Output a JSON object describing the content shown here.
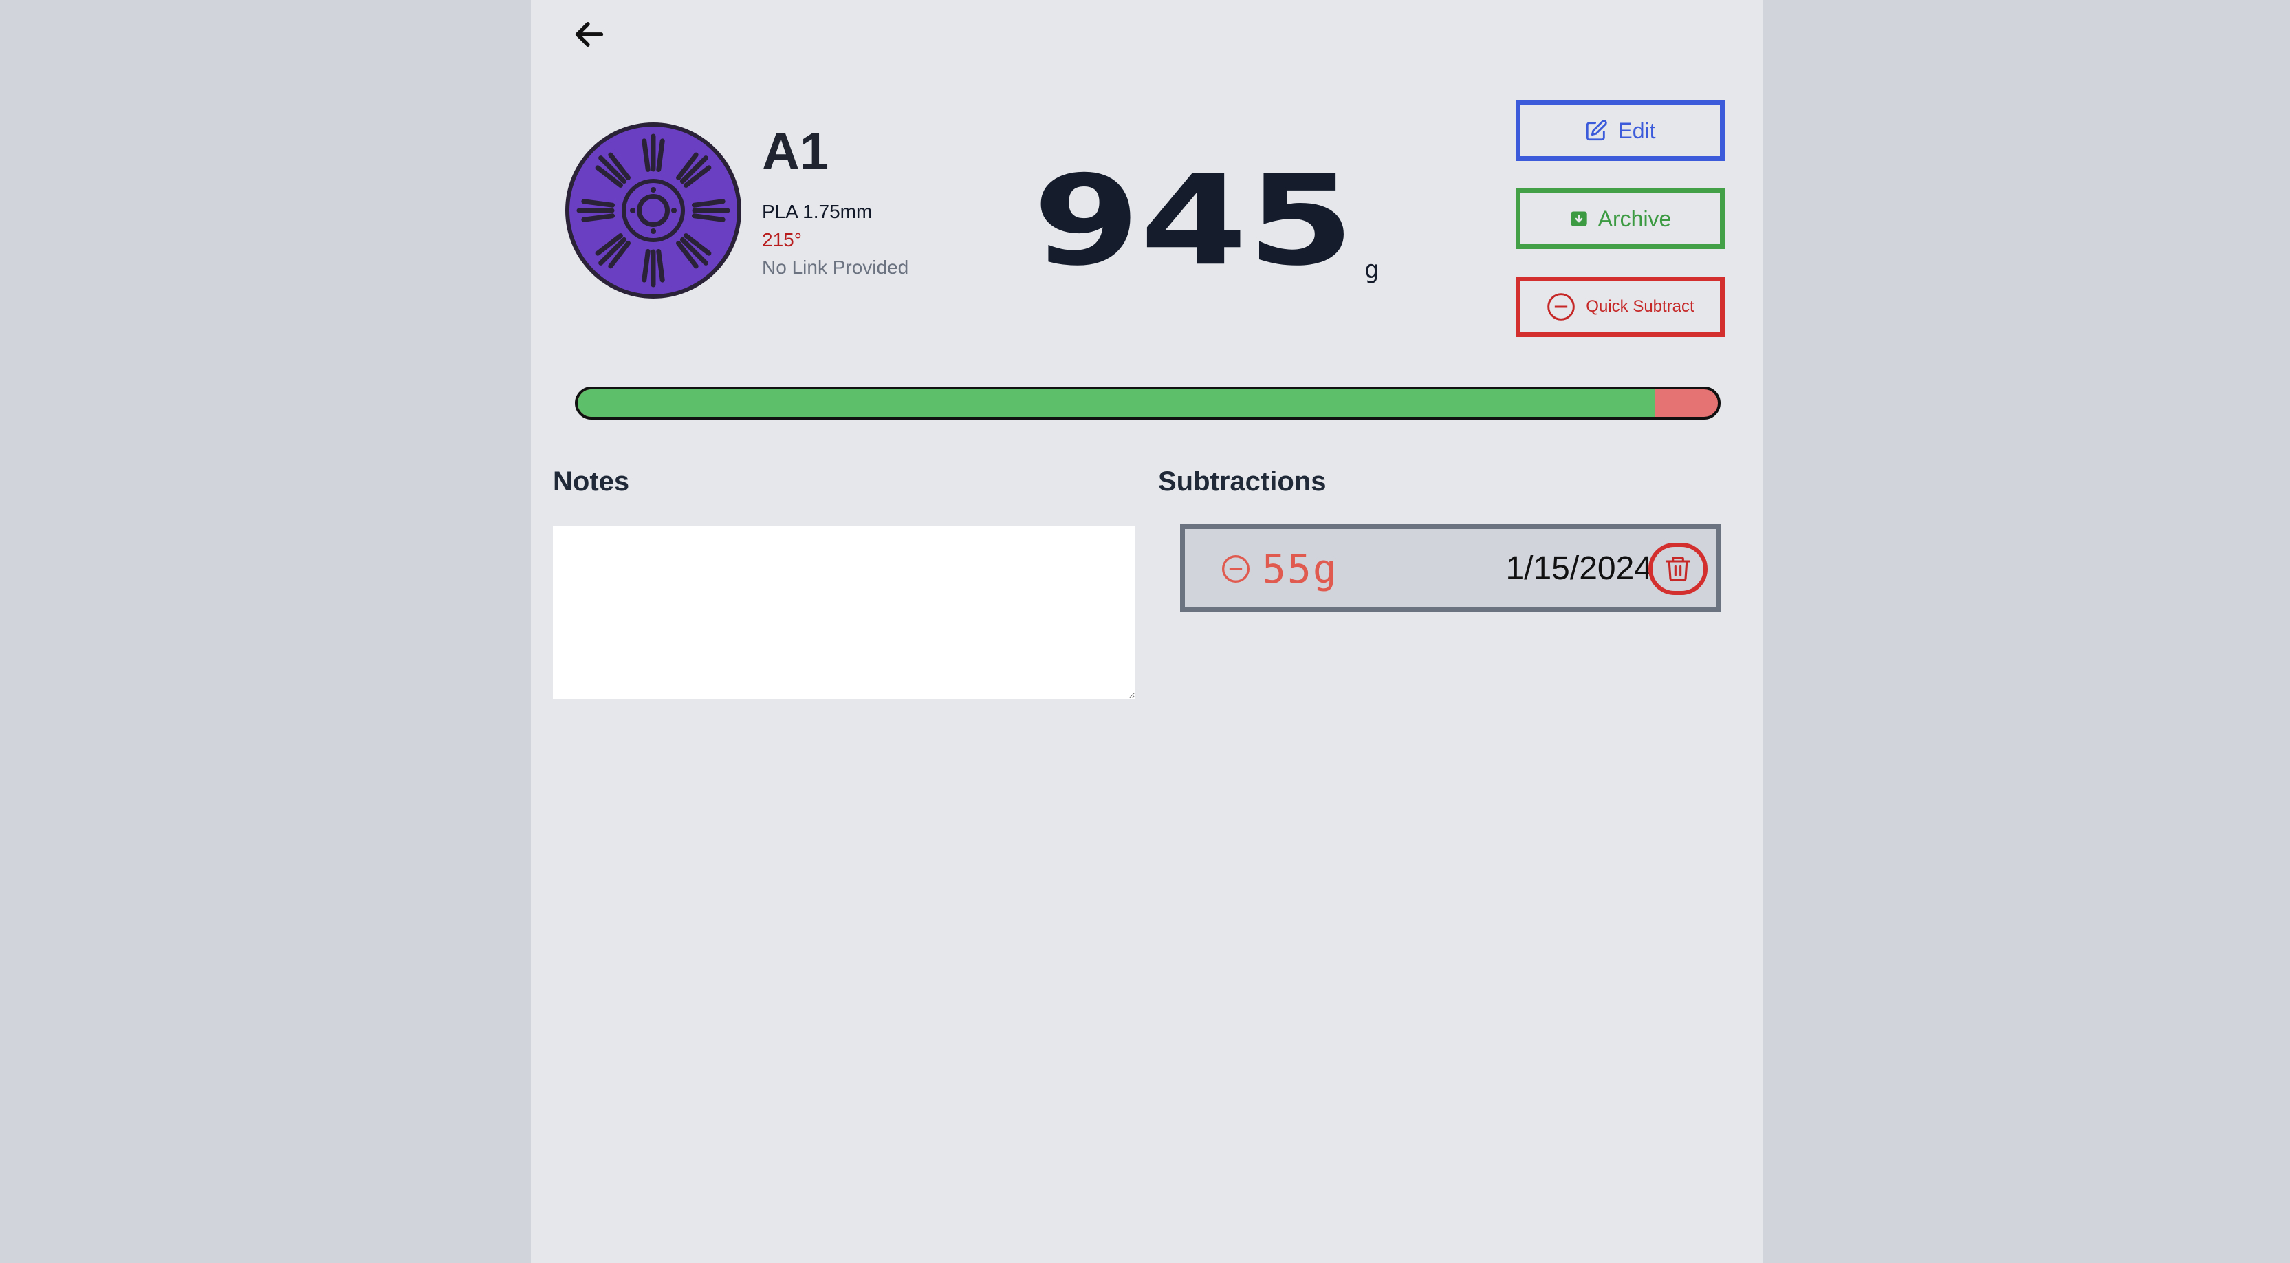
{
  "filament": {
    "name": "A1",
    "type": "PLA 1.75mm",
    "temperature": "215°",
    "link": "No Link Provided",
    "spool_color": "#6a3fc2"
  },
  "weight": {
    "value": "945",
    "unit": "g"
  },
  "actions": {
    "edit_label": "Edit",
    "archive_label": "Archive",
    "quick_subtract_label": "Quick Subtract"
  },
  "progress": {
    "remaining_fraction": 0.945,
    "fill_color": "#5dbf6a",
    "used_color": "#e57373"
  },
  "notes": {
    "title": "Notes",
    "value": ""
  },
  "subtractions": {
    "title": "Subtractions",
    "items": [
      {
        "amount": "55g",
        "date": "1/15/2024"
      }
    ]
  },
  "icons": {
    "back": "arrow-left-icon",
    "edit": "pencil-square-icon",
    "archive": "archive-box-icon",
    "quick_subtract": "minus-circle-icon",
    "delete": "trash-icon"
  }
}
